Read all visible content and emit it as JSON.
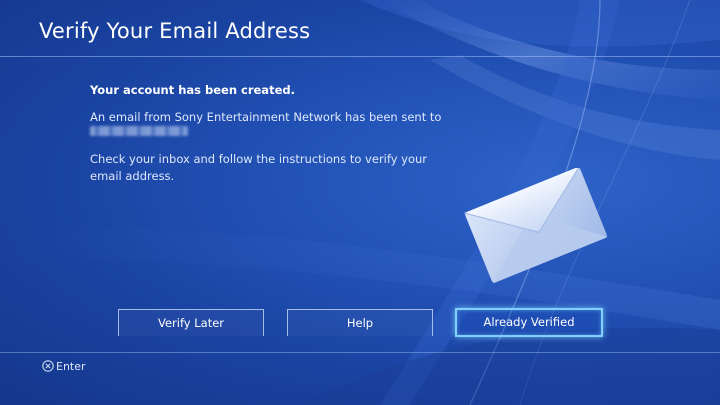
{
  "page": {
    "title": "Verify Your Email Address"
  },
  "message": {
    "created": "Your account has been created.",
    "sent": "An email from Sony Entertainment Network has been sent to",
    "email_masked": true,
    "instructions": "Check your inbox and follow the instructions to verify your email address."
  },
  "buttons": {
    "verify_later": "Verify Later",
    "help": "Help",
    "already_verified": "Already Verified",
    "focused": "already_verified"
  },
  "footer": {
    "hint_icon": "cross-button-icon",
    "hint_label": "Enter"
  },
  "colors": {
    "background": "#1f4cb0",
    "focus_glow": "#7fd0ff",
    "text": "#ffffff"
  }
}
